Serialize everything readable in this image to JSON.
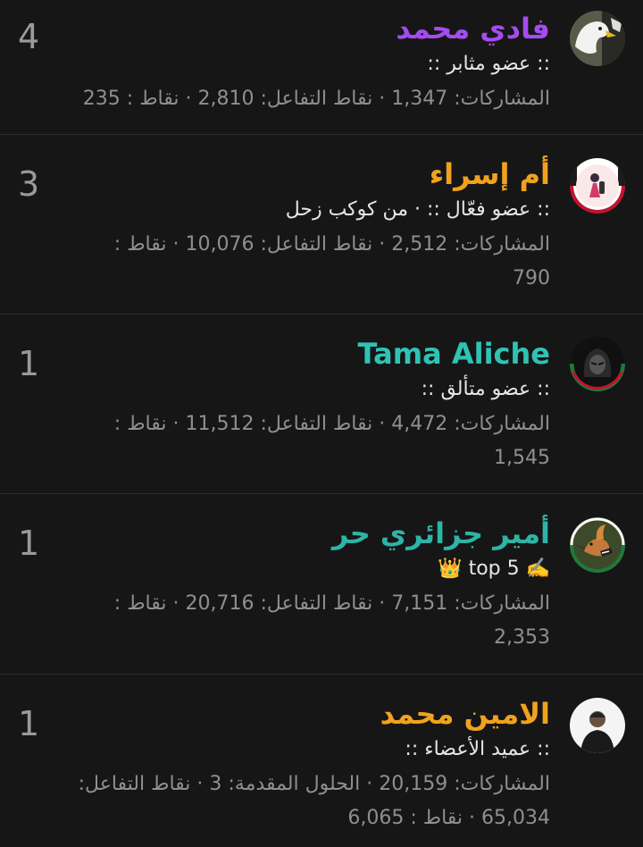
{
  "members": [
    {
      "name": "فادي محمد",
      "name_color": "#a44cf0",
      "rank": ":: عضو مثابر ::",
      "stats": "المشاركات: 1,347 · نقاط التفاعل: 2,810 · نقاط : 235",
      "count": "4",
      "avatar": "eagle-avatar"
    },
    {
      "name": "أم إسراء",
      "name_color": "#f0a21e",
      "rank": ":: عضو فعّال :: · من كوكب زحل",
      "stats": "المشاركات: 2,512 · نقاط التفاعل: 10,076 · نقاط : 790",
      "count": "3",
      "avatar": "girl-avatar"
    },
    {
      "name": "Tama Aliche",
      "name_color": "#2fc3b4",
      "rank": ":: عضو متألق ::",
      "stats": "المشاركات: 4,472 · نقاط التفاعل: 11,512 · نقاط : 1,545",
      "count": "1",
      "avatar": "hooded-figure-avatar"
    },
    {
      "name": "أمير جزائري حر",
      "name_color": "#2fb3a7",
      "rank": "✍️ top 5 👑",
      "stats": "المشاركات: 7,151 · نقاط التفاعل: 20,716 · نقاط : 2,353",
      "count": "1",
      "avatar": "hoopoe-bird-avatar"
    },
    {
      "name": "الامين محمد",
      "name_color": "#f0a21e",
      "rank": ":: عميد الأعضاء ::",
      "stats": "المشاركات: 20,159 · الحلول المقدمة: 3 · نقاط التفاعل: 65,034 · نقاط : 6,065",
      "count": "1",
      "avatar": "person-avatar"
    }
  ]
}
